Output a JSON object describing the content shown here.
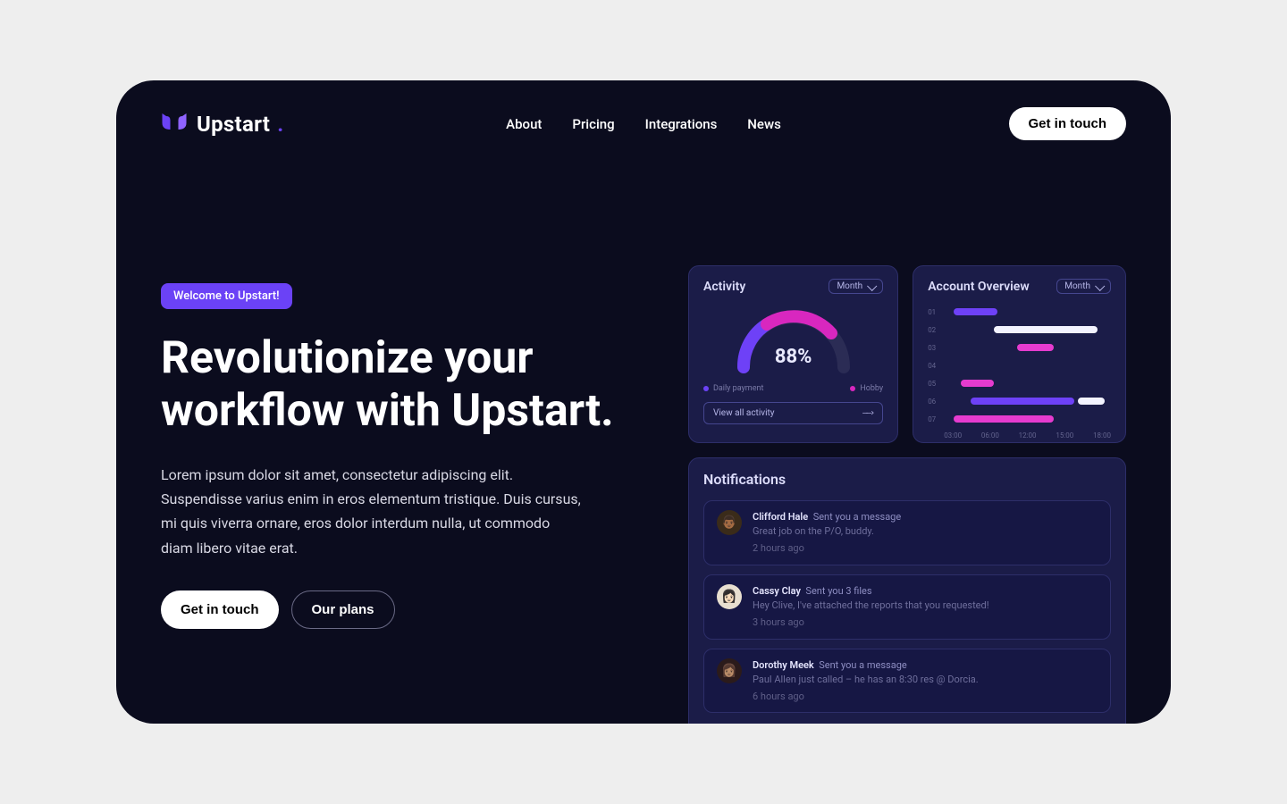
{
  "brand": {
    "name": "Upstart",
    "dot": "."
  },
  "nav": {
    "items": [
      "About",
      "Pricing",
      "Integrations",
      "News"
    ]
  },
  "header_cta": "Get in touch",
  "hero": {
    "badge": "Welcome to Upstart!",
    "headline": "Revolutionize your workflow with Upstart.",
    "sub": "Lorem ipsum dolor sit amet, consectetur adipiscing elit. Suspendisse varius enim in eros elementum tristique. Duis cursus, mi quis viverra ornare, eros dolor interdum nulla, ut commodo diam libero vitae erat.",
    "primary_btn": "Get in touch",
    "secondary_btn": "Our plans"
  },
  "dashboard": {
    "period_label": "Month",
    "activity": {
      "title": "Activity",
      "center": "88%",
      "legend1": "Daily payment",
      "legend2": "Hobby",
      "view_all": "View all activity"
    },
    "overview": {
      "title": "Account Overview",
      "rows": [
        "01",
        "02",
        "03",
        "04",
        "05",
        "06",
        "07"
      ],
      "axis": [
        "03:00",
        "06:00",
        "12:00",
        "15:00",
        "18:00"
      ]
    },
    "notifications": {
      "title": "Notifications",
      "items": [
        {
          "name": "Clifford Hale",
          "action": "Sent you a message",
          "body": "Great job on the P/O, buddy.",
          "time": "2 hours ago"
        },
        {
          "name": "Cassy Clay",
          "action": "Sent you 3 files",
          "body": "Hey Clive, I've attached the reports that you requested!",
          "time": "3 hours ago"
        },
        {
          "name": "Dorothy Meek",
          "action": "Sent you a message",
          "body": "Paul Allen just called – he has an 8:30 res @ Dorcia.",
          "time": "6 hours ago"
        }
      ]
    }
  }
}
